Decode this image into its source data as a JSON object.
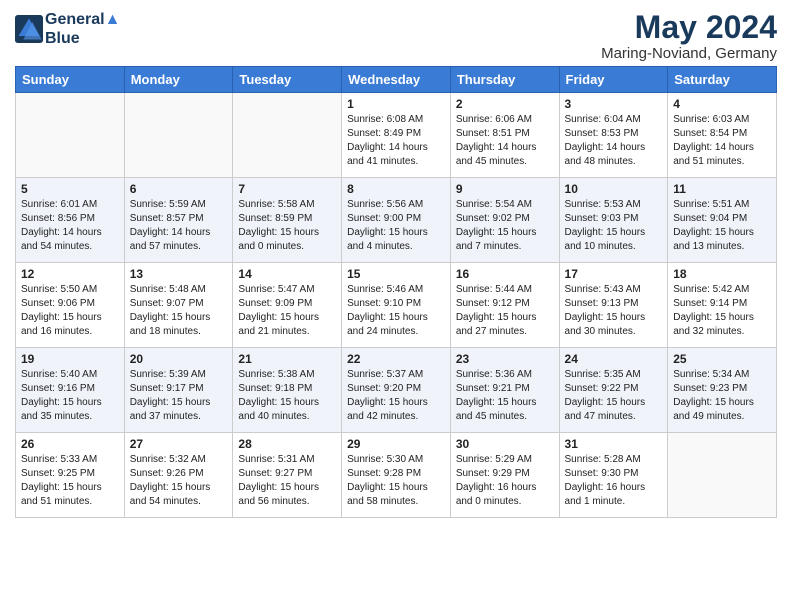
{
  "logo": {
    "line1": "General",
    "line2": "Blue"
  },
  "title": "May 2024",
  "location": "Maring-Noviand, Germany",
  "days_of_week": [
    "Sunday",
    "Monday",
    "Tuesday",
    "Wednesday",
    "Thursday",
    "Friday",
    "Saturday"
  ],
  "weeks": [
    [
      {
        "day": "",
        "info": ""
      },
      {
        "day": "",
        "info": ""
      },
      {
        "day": "",
        "info": ""
      },
      {
        "day": "1",
        "info": "Sunrise: 6:08 AM\nSunset: 8:49 PM\nDaylight: 14 hours\nand 41 minutes."
      },
      {
        "day": "2",
        "info": "Sunrise: 6:06 AM\nSunset: 8:51 PM\nDaylight: 14 hours\nand 45 minutes."
      },
      {
        "day": "3",
        "info": "Sunrise: 6:04 AM\nSunset: 8:53 PM\nDaylight: 14 hours\nand 48 minutes."
      },
      {
        "day": "4",
        "info": "Sunrise: 6:03 AM\nSunset: 8:54 PM\nDaylight: 14 hours\nand 51 minutes."
      }
    ],
    [
      {
        "day": "5",
        "info": "Sunrise: 6:01 AM\nSunset: 8:56 PM\nDaylight: 14 hours\nand 54 minutes."
      },
      {
        "day": "6",
        "info": "Sunrise: 5:59 AM\nSunset: 8:57 PM\nDaylight: 14 hours\nand 57 minutes."
      },
      {
        "day": "7",
        "info": "Sunrise: 5:58 AM\nSunset: 8:59 PM\nDaylight: 15 hours\nand 0 minutes."
      },
      {
        "day": "8",
        "info": "Sunrise: 5:56 AM\nSunset: 9:00 PM\nDaylight: 15 hours\nand 4 minutes."
      },
      {
        "day": "9",
        "info": "Sunrise: 5:54 AM\nSunset: 9:02 PM\nDaylight: 15 hours\nand 7 minutes."
      },
      {
        "day": "10",
        "info": "Sunrise: 5:53 AM\nSunset: 9:03 PM\nDaylight: 15 hours\nand 10 minutes."
      },
      {
        "day": "11",
        "info": "Sunrise: 5:51 AM\nSunset: 9:04 PM\nDaylight: 15 hours\nand 13 minutes."
      }
    ],
    [
      {
        "day": "12",
        "info": "Sunrise: 5:50 AM\nSunset: 9:06 PM\nDaylight: 15 hours\nand 16 minutes."
      },
      {
        "day": "13",
        "info": "Sunrise: 5:48 AM\nSunset: 9:07 PM\nDaylight: 15 hours\nand 18 minutes."
      },
      {
        "day": "14",
        "info": "Sunrise: 5:47 AM\nSunset: 9:09 PM\nDaylight: 15 hours\nand 21 minutes."
      },
      {
        "day": "15",
        "info": "Sunrise: 5:46 AM\nSunset: 9:10 PM\nDaylight: 15 hours\nand 24 minutes."
      },
      {
        "day": "16",
        "info": "Sunrise: 5:44 AM\nSunset: 9:12 PM\nDaylight: 15 hours\nand 27 minutes."
      },
      {
        "day": "17",
        "info": "Sunrise: 5:43 AM\nSunset: 9:13 PM\nDaylight: 15 hours\nand 30 minutes."
      },
      {
        "day": "18",
        "info": "Sunrise: 5:42 AM\nSunset: 9:14 PM\nDaylight: 15 hours\nand 32 minutes."
      }
    ],
    [
      {
        "day": "19",
        "info": "Sunrise: 5:40 AM\nSunset: 9:16 PM\nDaylight: 15 hours\nand 35 minutes."
      },
      {
        "day": "20",
        "info": "Sunrise: 5:39 AM\nSunset: 9:17 PM\nDaylight: 15 hours\nand 37 minutes."
      },
      {
        "day": "21",
        "info": "Sunrise: 5:38 AM\nSunset: 9:18 PM\nDaylight: 15 hours\nand 40 minutes."
      },
      {
        "day": "22",
        "info": "Sunrise: 5:37 AM\nSunset: 9:20 PM\nDaylight: 15 hours\nand 42 minutes."
      },
      {
        "day": "23",
        "info": "Sunrise: 5:36 AM\nSunset: 9:21 PM\nDaylight: 15 hours\nand 45 minutes."
      },
      {
        "day": "24",
        "info": "Sunrise: 5:35 AM\nSunset: 9:22 PM\nDaylight: 15 hours\nand 47 minutes."
      },
      {
        "day": "25",
        "info": "Sunrise: 5:34 AM\nSunset: 9:23 PM\nDaylight: 15 hours\nand 49 minutes."
      }
    ],
    [
      {
        "day": "26",
        "info": "Sunrise: 5:33 AM\nSunset: 9:25 PM\nDaylight: 15 hours\nand 51 minutes."
      },
      {
        "day": "27",
        "info": "Sunrise: 5:32 AM\nSunset: 9:26 PM\nDaylight: 15 hours\nand 54 minutes."
      },
      {
        "day": "28",
        "info": "Sunrise: 5:31 AM\nSunset: 9:27 PM\nDaylight: 15 hours\nand 56 minutes."
      },
      {
        "day": "29",
        "info": "Sunrise: 5:30 AM\nSunset: 9:28 PM\nDaylight: 15 hours\nand 58 minutes."
      },
      {
        "day": "30",
        "info": "Sunrise: 5:29 AM\nSunset: 9:29 PM\nDaylight: 16 hours\nand 0 minutes."
      },
      {
        "day": "31",
        "info": "Sunrise: 5:28 AM\nSunset: 9:30 PM\nDaylight: 16 hours\nand 1 minute."
      },
      {
        "day": "",
        "info": ""
      }
    ]
  ]
}
